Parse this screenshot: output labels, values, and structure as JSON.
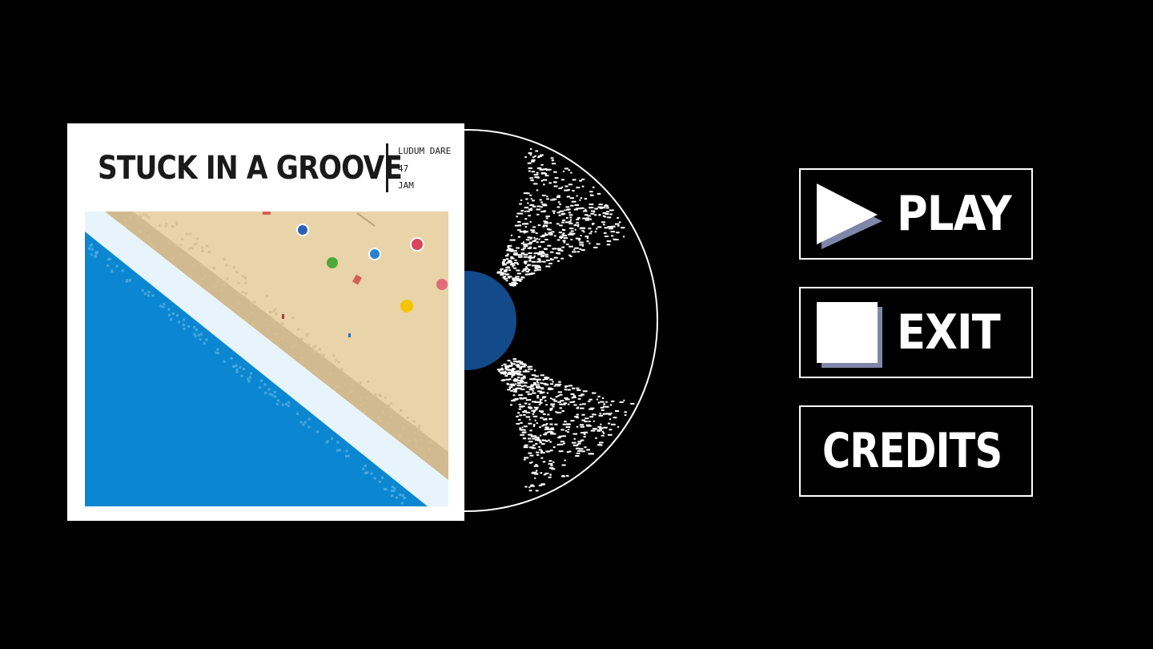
{
  "album": {
    "title": "STUCK IN A GROOVE",
    "meta": [
      "LUDUM DARE",
      "47",
      "JAM"
    ]
  },
  "menu": {
    "play": {
      "label": "PLAY",
      "icon": "play-triangle-icon"
    },
    "exit": {
      "label": "EXIT",
      "icon": "stop-square-icon"
    },
    "credits": {
      "label": "CREDITS"
    }
  },
  "colors": {
    "background": "#000000",
    "sleeve": "#ffffff",
    "sand": "#e9d3a9",
    "sand_dark": "#cdb58b",
    "sea": "#0a87d0",
    "foam": "#e8f4fb",
    "record_label": "#134a89",
    "icon_shadow": "#7f86a8",
    "text_dark": "#1a1a1a"
  }
}
